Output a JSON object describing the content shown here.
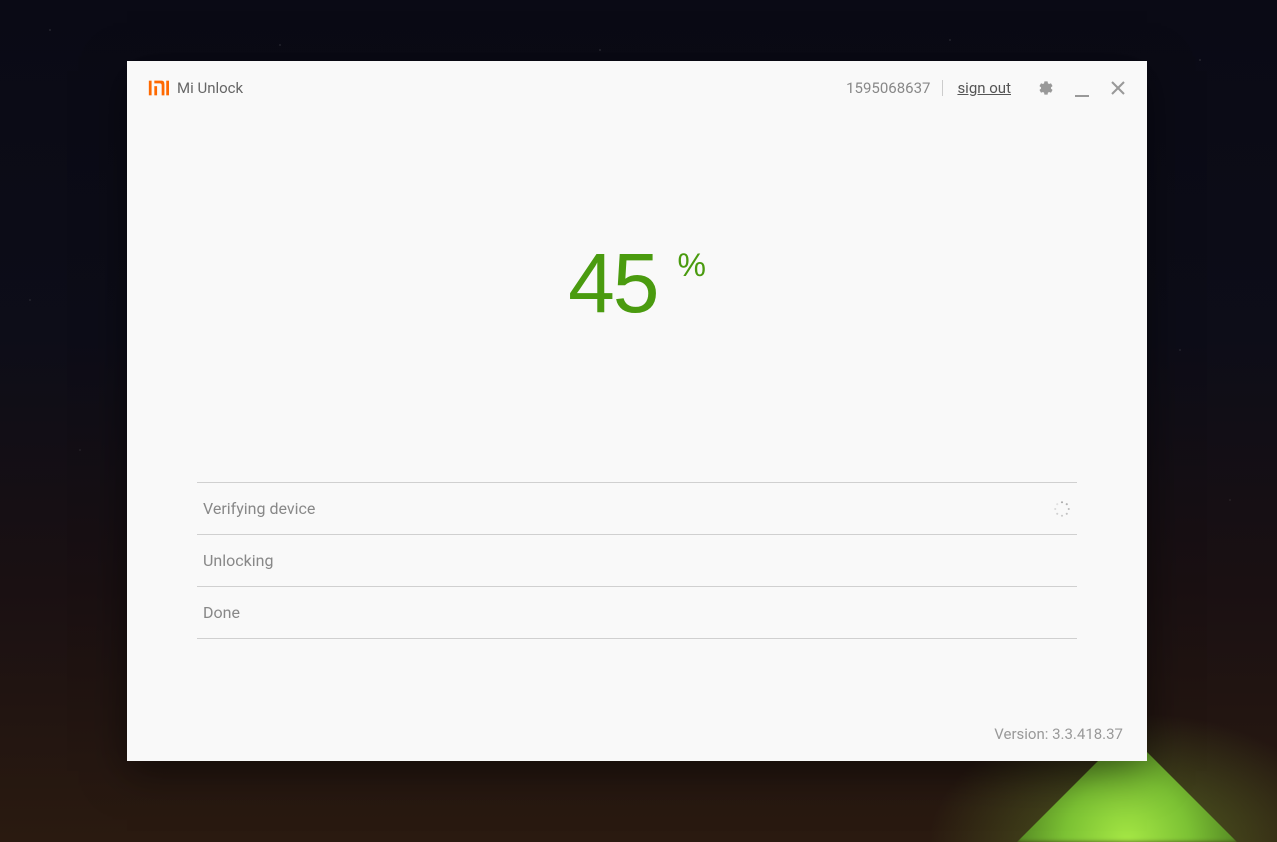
{
  "header": {
    "app_title": "Mi Unlock",
    "account_number": "1595068637",
    "signout_label": "sign out"
  },
  "progress": {
    "value": "45",
    "symbol": "%"
  },
  "steps": [
    {
      "label": "Verifying device",
      "active": true
    },
    {
      "label": "Unlocking",
      "active": false
    },
    {
      "label": "Done",
      "active": false
    }
  ],
  "footer": {
    "version_label": "Version: 3.3.418.37"
  }
}
